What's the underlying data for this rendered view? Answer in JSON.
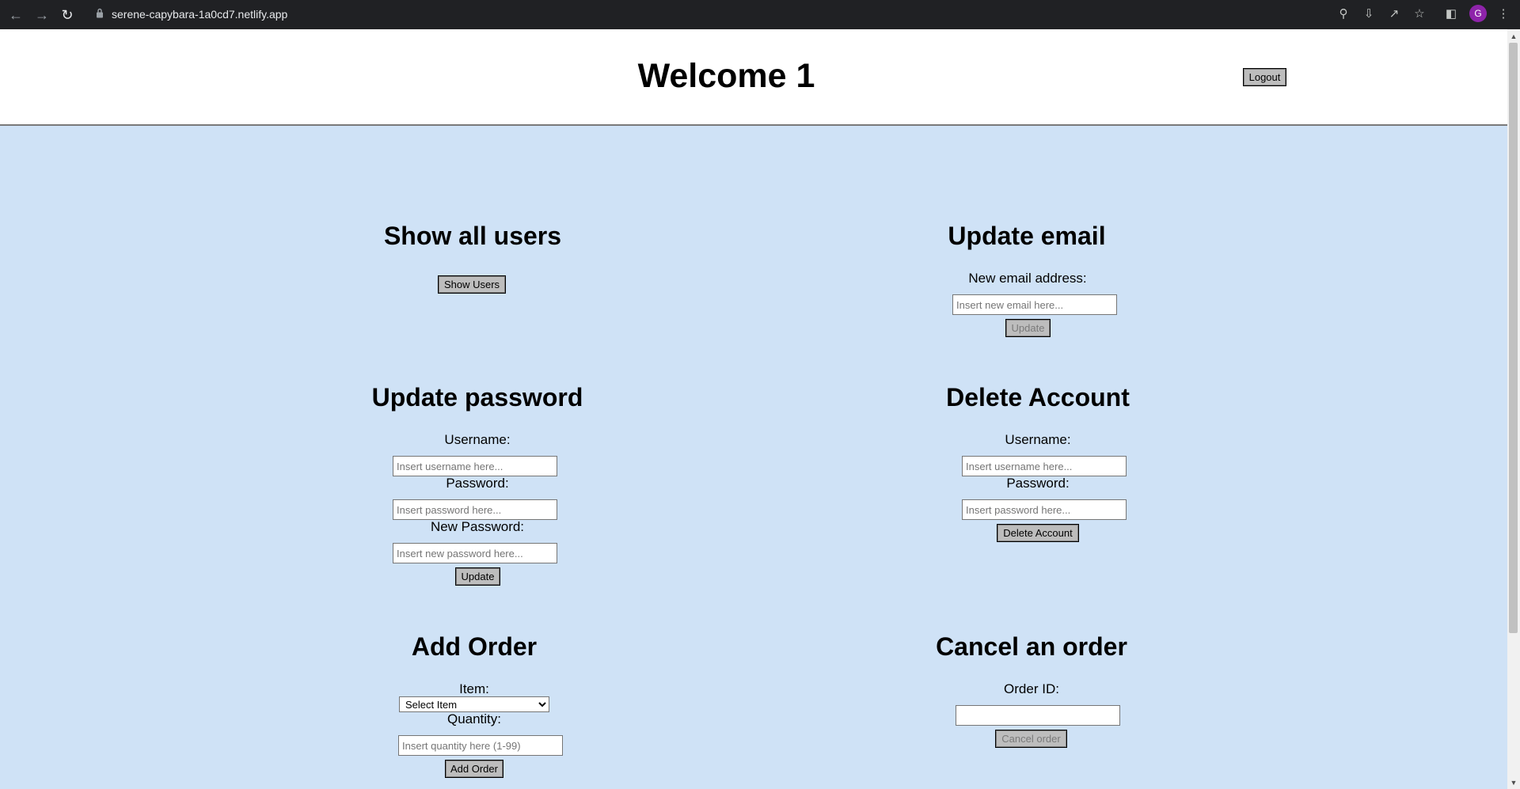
{
  "browser": {
    "url": "serene-capybara-1a0cd7.netlify.app",
    "avatar_letter": "G",
    "icons": [
      "back-icon",
      "forward-icon",
      "reload-icon",
      "lock-icon",
      "key-icon",
      "install-icon",
      "share-icon",
      "star-icon",
      "side-panel-icon",
      "more-icon"
    ]
  },
  "header": {
    "title": "Welcome 1",
    "logout_label": "Logout"
  },
  "show_users": {
    "title": "Show all users",
    "button_label": "Show Users"
  },
  "update_email": {
    "title": "Update email",
    "email_label": "New email address:",
    "email_placeholder": "Insert new email here...",
    "button_label": "Update"
  },
  "update_password": {
    "title": "Update password",
    "username_label": "Username:",
    "username_placeholder": "Insert username here...",
    "password_label": "Password:",
    "password_placeholder": "Insert password here...",
    "new_password_label": "New Password:",
    "new_password_placeholder": "Insert new password here...",
    "button_label": "Update"
  },
  "delete_account": {
    "title": "Delete Account",
    "username_label": "Username:",
    "username_placeholder": "Insert username here...",
    "password_label": "Password:",
    "password_placeholder": "Insert password here...",
    "button_label": "Delete Account"
  },
  "add_order": {
    "title": "Add Order",
    "item_label": "Item:",
    "item_selected": "Select Item",
    "quantity_label": "Quantity:",
    "quantity_placeholder": "Insert quantity here (1-99)",
    "button_label": "Add Order"
  },
  "cancel_order": {
    "title": "Cancel an order",
    "order_id_label": "Order ID:",
    "order_id_value": "",
    "button_label": "Cancel order"
  },
  "colors": {
    "background": "#cfe2f6",
    "button": "#bdbdbd",
    "chrome": "#202124",
    "avatar": "#8e24aa"
  }
}
